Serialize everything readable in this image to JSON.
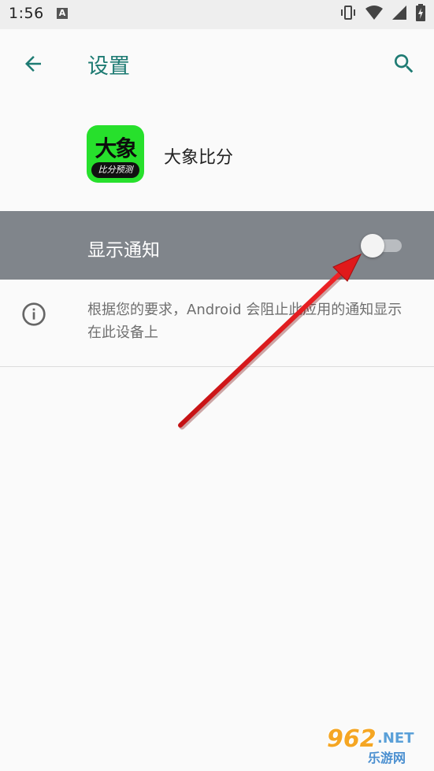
{
  "status_bar": {
    "time": "1:56",
    "notification_badge": "A",
    "icons": [
      "vibrate-icon",
      "wifi-icon",
      "signal-icon",
      "battery-charging-icon"
    ]
  },
  "app_bar": {
    "title": "设置",
    "back_icon": "arrow-back-icon",
    "search_icon": "search-icon",
    "accent_color": "#1e7b73"
  },
  "app": {
    "name": "大象比分",
    "icon_text_main": "大象",
    "icon_text_sub": "比分预测",
    "icon_color": "#27e02c"
  },
  "notification_setting": {
    "label": "显示通知",
    "enabled": false,
    "row_color": "#80858b"
  },
  "info": {
    "icon": "info-icon",
    "text": "根据您的要求，Android 会阻止此应用的通知显示在此设备上"
  },
  "annotation": {
    "type": "red-arrow",
    "points_to": "notification-toggle",
    "color": "#e0191b"
  },
  "watermark": {
    "number": "962",
    "suffix": ".NET",
    "chinese": "乐游网"
  }
}
